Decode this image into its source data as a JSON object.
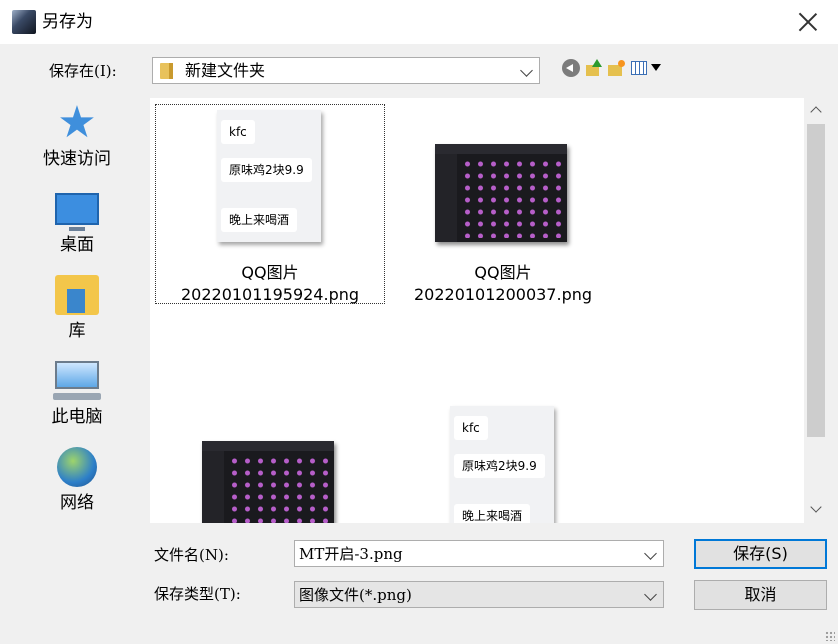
{
  "window": {
    "title": "另存为"
  },
  "lookin": {
    "label": "保存在(I):",
    "value": "新建文件夹"
  },
  "places": [
    {
      "label": "快速访问",
      "icon": "star-icon"
    },
    {
      "label": "桌面",
      "icon": "desktop-icon"
    },
    {
      "label": "库",
      "icon": "library-icon"
    },
    {
      "label": "此电脑",
      "icon": "computer-icon"
    },
    {
      "label": "网络",
      "icon": "network-icon"
    }
  ],
  "files": [
    {
      "name_line1": "QQ图片",
      "name_line2": "20220101195924.png",
      "thumb": "chat",
      "selected": true
    },
    {
      "name_line1": "QQ图片",
      "name_line2": "20220101200037.png",
      "thumb": "dark",
      "selected": false
    },
    {
      "thumb": "dark"
    },
    {
      "thumb": "chat"
    }
  ],
  "chat_thumb": {
    "line1": "kfc",
    "line2": "原味鸡2块9.9",
    "line3": "晚上来喝酒"
  },
  "filename": {
    "label": "文件名(N):",
    "value": "MT开启-3.png"
  },
  "filetype": {
    "label": "保存类型(T):",
    "value": "图像文件(*.png)"
  },
  "buttons": {
    "save": "保存(S)",
    "cancel": "取消"
  },
  "colors": {
    "default_button_border": "#0078d7",
    "list_bg": "#ffffff",
    "dialog_bg": "#f0f0f0"
  }
}
